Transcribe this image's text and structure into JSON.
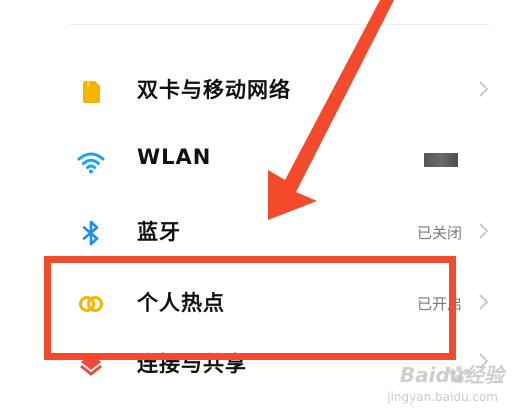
{
  "settings": {
    "items": [
      {
        "label": "双卡与移动网络",
        "status": "",
        "icon": "sim-card-icon",
        "icon_color": "#f5b400"
      },
      {
        "label": "WLAN",
        "status": "",
        "icon": "wifi-icon",
        "icon_color": "#1aa3f0"
      },
      {
        "label": "蓝牙",
        "status": "已关闭",
        "icon": "bluetooth-icon",
        "icon_color": "#1a8ff0"
      },
      {
        "label": "个人热点",
        "status": "已开启",
        "icon": "hotspot-icon",
        "icon_color": "#f2b800"
      },
      {
        "label": "连接与共享",
        "status": "",
        "icon": "connection-share-icon",
        "icon_color": "#f04a3a"
      }
    ]
  },
  "annotation": {
    "color": "#f24a2b"
  },
  "watermark": {
    "brand": "Baidu经验",
    "url": "jingyan.baidu.com"
  }
}
